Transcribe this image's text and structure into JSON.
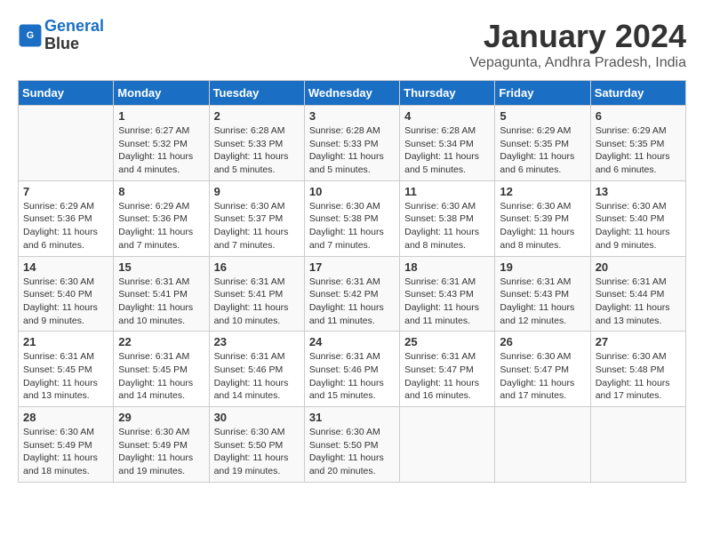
{
  "header": {
    "logo_line1": "General",
    "logo_line2": "Blue",
    "month_title": "January 2024",
    "location": "Vepagunta, Andhra Pradesh, India"
  },
  "columns": [
    "Sunday",
    "Monday",
    "Tuesday",
    "Wednesday",
    "Thursday",
    "Friday",
    "Saturday"
  ],
  "weeks": [
    [
      {
        "day": "",
        "sunrise": "",
        "sunset": "",
        "daylight": ""
      },
      {
        "day": "1",
        "sunrise": "Sunrise: 6:27 AM",
        "sunset": "Sunset: 5:32 PM",
        "daylight": "Daylight: 11 hours and 4 minutes."
      },
      {
        "day": "2",
        "sunrise": "Sunrise: 6:28 AM",
        "sunset": "Sunset: 5:33 PM",
        "daylight": "Daylight: 11 hours and 5 minutes."
      },
      {
        "day": "3",
        "sunrise": "Sunrise: 6:28 AM",
        "sunset": "Sunset: 5:33 PM",
        "daylight": "Daylight: 11 hours and 5 minutes."
      },
      {
        "day": "4",
        "sunrise": "Sunrise: 6:28 AM",
        "sunset": "Sunset: 5:34 PM",
        "daylight": "Daylight: 11 hours and 5 minutes."
      },
      {
        "day": "5",
        "sunrise": "Sunrise: 6:29 AM",
        "sunset": "Sunset: 5:35 PM",
        "daylight": "Daylight: 11 hours and 6 minutes."
      },
      {
        "day": "6",
        "sunrise": "Sunrise: 6:29 AM",
        "sunset": "Sunset: 5:35 PM",
        "daylight": "Daylight: 11 hours and 6 minutes."
      }
    ],
    [
      {
        "day": "7",
        "sunrise": "Sunrise: 6:29 AM",
        "sunset": "Sunset: 5:36 PM",
        "daylight": "Daylight: 11 hours and 6 minutes."
      },
      {
        "day": "8",
        "sunrise": "Sunrise: 6:29 AM",
        "sunset": "Sunset: 5:36 PM",
        "daylight": "Daylight: 11 hours and 7 minutes."
      },
      {
        "day": "9",
        "sunrise": "Sunrise: 6:30 AM",
        "sunset": "Sunset: 5:37 PM",
        "daylight": "Daylight: 11 hours and 7 minutes."
      },
      {
        "day": "10",
        "sunrise": "Sunrise: 6:30 AM",
        "sunset": "Sunset: 5:38 PM",
        "daylight": "Daylight: 11 hours and 7 minutes."
      },
      {
        "day": "11",
        "sunrise": "Sunrise: 6:30 AM",
        "sunset": "Sunset: 5:38 PM",
        "daylight": "Daylight: 11 hours and 8 minutes."
      },
      {
        "day": "12",
        "sunrise": "Sunrise: 6:30 AM",
        "sunset": "Sunset: 5:39 PM",
        "daylight": "Daylight: 11 hours and 8 minutes."
      },
      {
        "day": "13",
        "sunrise": "Sunrise: 6:30 AM",
        "sunset": "Sunset: 5:40 PM",
        "daylight": "Daylight: 11 hours and 9 minutes."
      }
    ],
    [
      {
        "day": "14",
        "sunrise": "Sunrise: 6:30 AM",
        "sunset": "Sunset: 5:40 PM",
        "daylight": "Daylight: 11 hours and 9 minutes."
      },
      {
        "day": "15",
        "sunrise": "Sunrise: 6:31 AM",
        "sunset": "Sunset: 5:41 PM",
        "daylight": "Daylight: 11 hours and 10 minutes."
      },
      {
        "day": "16",
        "sunrise": "Sunrise: 6:31 AM",
        "sunset": "Sunset: 5:41 PM",
        "daylight": "Daylight: 11 hours and 10 minutes."
      },
      {
        "day": "17",
        "sunrise": "Sunrise: 6:31 AM",
        "sunset": "Sunset: 5:42 PM",
        "daylight": "Daylight: 11 hours and 11 minutes."
      },
      {
        "day": "18",
        "sunrise": "Sunrise: 6:31 AM",
        "sunset": "Sunset: 5:43 PM",
        "daylight": "Daylight: 11 hours and 11 minutes."
      },
      {
        "day": "19",
        "sunrise": "Sunrise: 6:31 AM",
        "sunset": "Sunset: 5:43 PM",
        "daylight": "Daylight: 11 hours and 12 minutes."
      },
      {
        "day": "20",
        "sunrise": "Sunrise: 6:31 AM",
        "sunset": "Sunset: 5:44 PM",
        "daylight": "Daylight: 11 hours and 13 minutes."
      }
    ],
    [
      {
        "day": "21",
        "sunrise": "Sunrise: 6:31 AM",
        "sunset": "Sunset: 5:45 PM",
        "daylight": "Daylight: 11 hours and 13 minutes."
      },
      {
        "day": "22",
        "sunrise": "Sunrise: 6:31 AM",
        "sunset": "Sunset: 5:45 PM",
        "daylight": "Daylight: 11 hours and 14 minutes."
      },
      {
        "day": "23",
        "sunrise": "Sunrise: 6:31 AM",
        "sunset": "Sunset: 5:46 PM",
        "daylight": "Daylight: 11 hours and 14 minutes."
      },
      {
        "day": "24",
        "sunrise": "Sunrise: 6:31 AM",
        "sunset": "Sunset: 5:46 PM",
        "daylight": "Daylight: 11 hours and 15 minutes."
      },
      {
        "day": "25",
        "sunrise": "Sunrise: 6:31 AM",
        "sunset": "Sunset: 5:47 PM",
        "daylight": "Daylight: 11 hours and 16 minutes."
      },
      {
        "day": "26",
        "sunrise": "Sunrise: 6:30 AM",
        "sunset": "Sunset: 5:47 PM",
        "daylight": "Daylight: 11 hours and 17 minutes."
      },
      {
        "day": "27",
        "sunrise": "Sunrise: 6:30 AM",
        "sunset": "Sunset: 5:48 PM",
        "daylight": "Daylight: 11 hours and 17 minutes."
      }
    ],
    [
      {
        "day": "28",
        "sunrise": "Sunrise: 6:30 AM",
        "sunset": "Sunset: 5:49 PM",
        "daylight": "Daylight: 11 hours and 18 minutes."
      },
      {
        "day": "29",
        "sunrise": "Sunrise: 6:30 AM",
        "sunset": "Sunset: 5:49 PM",
        "daylight": "Daylight: 11 hours and 19 minutes."
      },
      {
        "day": "30",
        "sunrise": "Sunrise: 6:30 AM",
        "sunset": "Sunset: 5:50 PM",
        "daylight": "Daylight: 11 hours and 19 minutes."
      },
      {
        "day": "31",
        "sunrise": "Sunrise: 6:30 AM",
        "sunset": "Sunset: 5:50 PM",
        "daylight": "Daylight: 11 hours and 20 minutes."
      },
      {
        "day": "",
        "sunrise": "",
        "sunset": "",
        "daylight": ""
      },
      {
        "day": "",
        "sunrise": "",
        "sunset": "",
        "daylight": ""
      },
      {
        "day": "",
        "sunrise": "",
        "sunset": "",
        "daylight": ""
      }
    ]
  ]
}
